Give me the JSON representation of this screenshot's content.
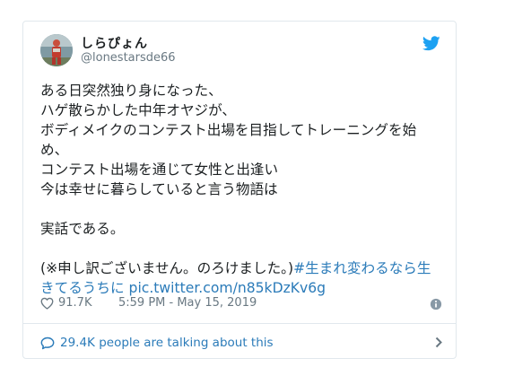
{
  "user": {
    "display_name": "しらぴょん",
    "handle": "@lonestarsde66"
  },
  "tweet": {
    "lines": [
      "ある日突然独り身になった、",
      "ハゲ散らかした中年オヤジが、",
      "ボディメイクのコンテスト出場を目指してトレーニングを始",
      "め、",
      "コンテスト出場を通じて女性と出逢い",
      "今は幸せに暮らしていると言う物語は",
      "",
      "実話である。",
      "",
      "(※申し訳ございません。のろけました。)"
    ],
    "hashtag_part1": "#生まれ変わるなら生",
    "hashtag_part2": "きてるうちに",
    "pic_link": "pic.twitter.com/n85kDzKv6g"
  },
  "meta": {
    "likes": "91.7K",
    "timestamp": "5:59 PM - May 15, 2019"
  },
  "footer": {
    "talking": "29.4K people are talking about this"
  },
  "colors": {
    "link": "#2b7bb9",
    "secondary_text": "#697882",
    "twitter_blue": "#1da1f2",
    "border": "#e1e8ed"
  },
  "icons": {
    "brand": "twitter-bird-icon",
    "likes": "heart-icon",
    "info": "info-icon",
    "conversation": "bubble-icon",
    "more": "chevron-right-icon"
  }
}
